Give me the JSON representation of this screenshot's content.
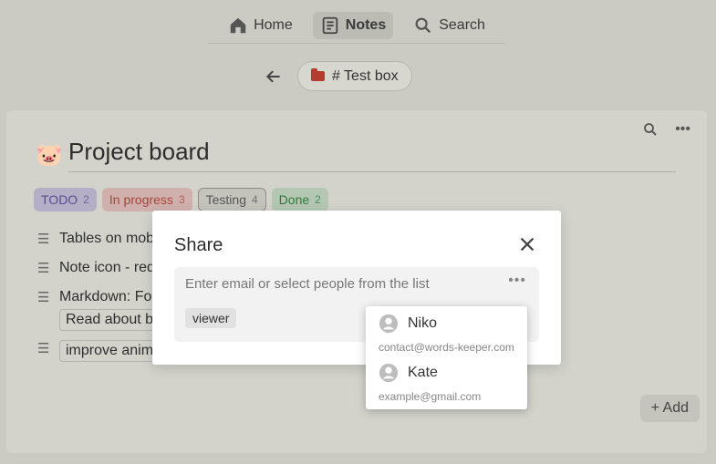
{
  "nav": {
    "home": "Home",
    "notes": "Notes",
    "search": "Search"
  },
  "breadcrumb": {
    "chip_label": "# Test box"
  },
  "board": {
    "title": "Project board",
    "tags": [
      {
        "label": "TODO",
        "count": "2"
      },
      {
        "label": "In progress",
        "count": "3"
      },
      {
        "label": "Testing",
        "count": "4"
      },
      {
        "label": "Done",
        "count": "2"
      }
    ],
    "rows": [
      {
        "text": "Tables on mob"
      },
      {
        "text": "Note icon - red"
      },
      {
        "text": "Markdown: Fo",
        "sub": "Read about b"
      },
      {
        "text": "improve anima"
      }
    ],
    "add_label": "+ Add"
  },
  "modal": {
    "title": "Share",
    "input_placeholder": "Enter email or select people from the list",
    "role": "viewer"
  },
  "people": [
    {
      "name": "Niko",
      "email": "contact@words-keeper.com"
    },
    {
      "name": "Kate",
      "email": "example@gmail.com"
    }
  ],
  "icons": {
    "home": "home-icon",
    "notes": "notes-icon",
    "search": "search-icon",
    "back": "back-arrow-icon",
    "folder": "folder-icon",
    "close": "close-icon",
    "more": "more-dots-icon",
    "avatar": "user-avatar-icon"
  },
  "colors": {
    "folder": "#b33b30",
    "todo_text": "#5b4d8f",
    "progress_text": "#a8453b",
    "done_text": "#2f7a3a"
  }
}
